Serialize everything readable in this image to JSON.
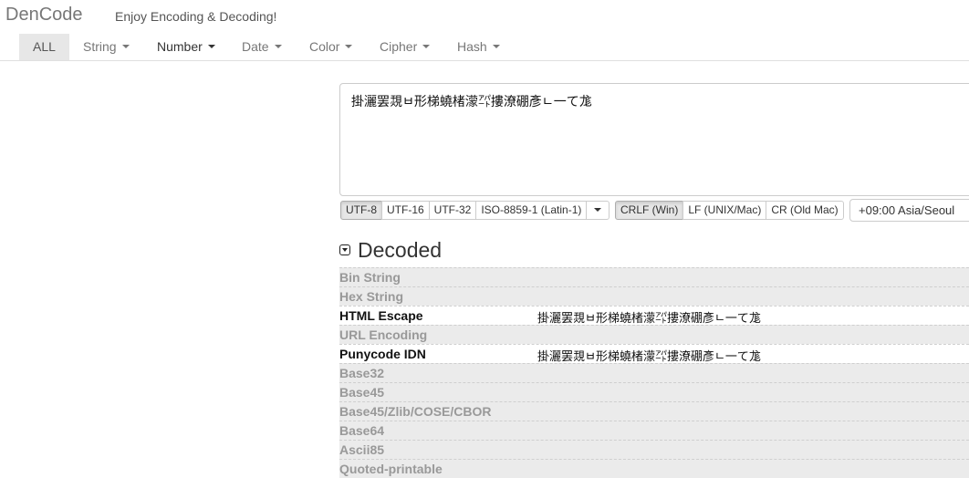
{
  "header": {
    "brand": "DenCode",
    "tagline": "Enjoy Encoding & Decoding!"
  },
  "nav": [
    {
      "label": "ALL",
      "active": true
    },
    {
      "label": "String"
    },
    {
      "label": "Number"
    },
    {
      "label": "Date"
    },
    {
      "label": "Color"
    },
    {
      "label": "Cipher"
    },
    {
      "label": "Hash"
    }
  ],
  "input": {
    "text": "掛灑罢覝ㅂ形梯蟯楮濛㌀摟潦硼彥ㄴ一て尨"
  },
  "encoding_buttons": [
    "UTF-8",
    "UTF-16",
    "UTF-32",
    "ISO-8859-1 (Latin-1)"
  ],
  "newline_buttons": [
    "CRLF (Win)",
    "LF (UNIX/Mac)",
    "CR (Old Mac)"
  ],
  "timezone": "+09:00 Asia/Seoul",
  "decoded": {
    "title": "Decoded",
    "rows": [
      {
        "name": "Bin String",
        "value": ""
      },
      {
        "name": "Hex String",
        "value": ""
      },
      {
        "name": "HTML Escape",
        "value": "掛灑罢覝ㅂ形梯蟯楮濛㌀摟潦硼彥ㄴ一て尨"
      },
      {
        "name": "URL Encoding",
        "value": ""
      },
      {
        "name": "Punycode IDN",
        "value": "掛灑罢覝ㅂ形梯蟯楮濛㌀摟潦硼彥ㄴ一て尨"
      },
      {
        "name": "Base32",
        "value": ""
      },
      {
        "name": "Base45",
        "value": ""
      },
      {
        "name": "Base45/Zlib/COSE/CBOR",
        "value": ""
      },
      {
        "name": "Base64",
        "value": ""
      },
      {
        "name": "Ascii85",
        "value": ""
      },
      {
        "name": "Quoted-printable",
        "value": ""
      }
    ]
  }
}
